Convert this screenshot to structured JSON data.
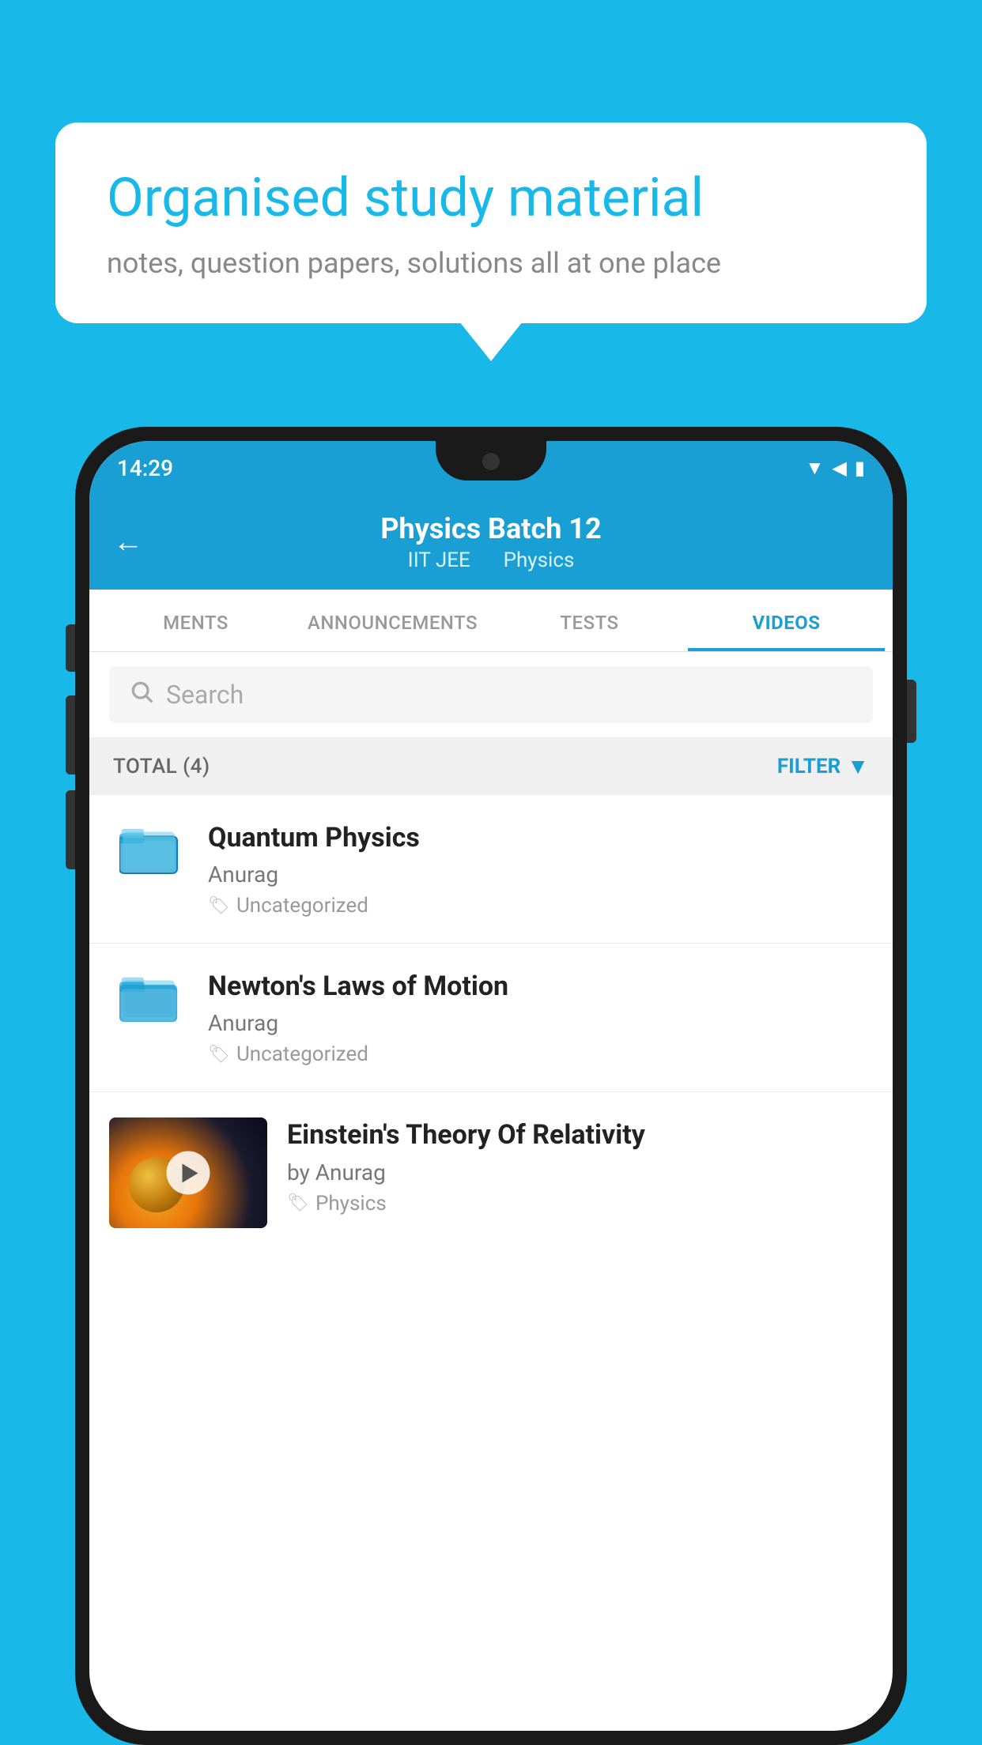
{
  "page": {
    "background_color": "#18b8e8"
  },
  "speech_bubble": {
    "title": "Organised study material",
    "subtitle": "notes, question papers, solutions all at one place"
  },
  "phone": {
    "status_bar": {
      "time": "14:29",
      "icons": "▼◀▮"
    },
    "header": {
      "back_label": "←",
      "title": "Physics Batch 12",
      "subtitle_left": "IIT JEE",
      "subtitle_right": "Physics"
    },
    "tabs": [
      {
        "label": "MENTS",
        "active": false
      },
      {
        "label": "ANNOUNCEMENTS",
        "active": false
      },
      {
        "label": "TESTS",
        "active": false
      },
      {
        "label": "VIDEOS",
        "active": true
      }
    ],
    "search": {
      "placeholder": "Search"
    },
    "filter_bar": {
      "total_label": "TOTAL (4)",
      "filter_label": "FILTER"
    },
    "video_items": [
      {
        "id": "quantum",
        "title": "Quantum Physics",
        "author": "Anurag",
        "tag": "Uncategorized",
        "type": "folder"
      },
      {
        "id": "newton",
        "title": "Newton's Laws of Motion",
        "author": "Anurag",
        "tag": "Uncategorized",
        "type": "folder"
      },
      {
        "id": "einstein",
        "title": "Einstein's Theory Of Relativity",
        "author": "by Anurag",
        "tag": "Physics",
        "type": "video"
      }
    ]
  }
}
